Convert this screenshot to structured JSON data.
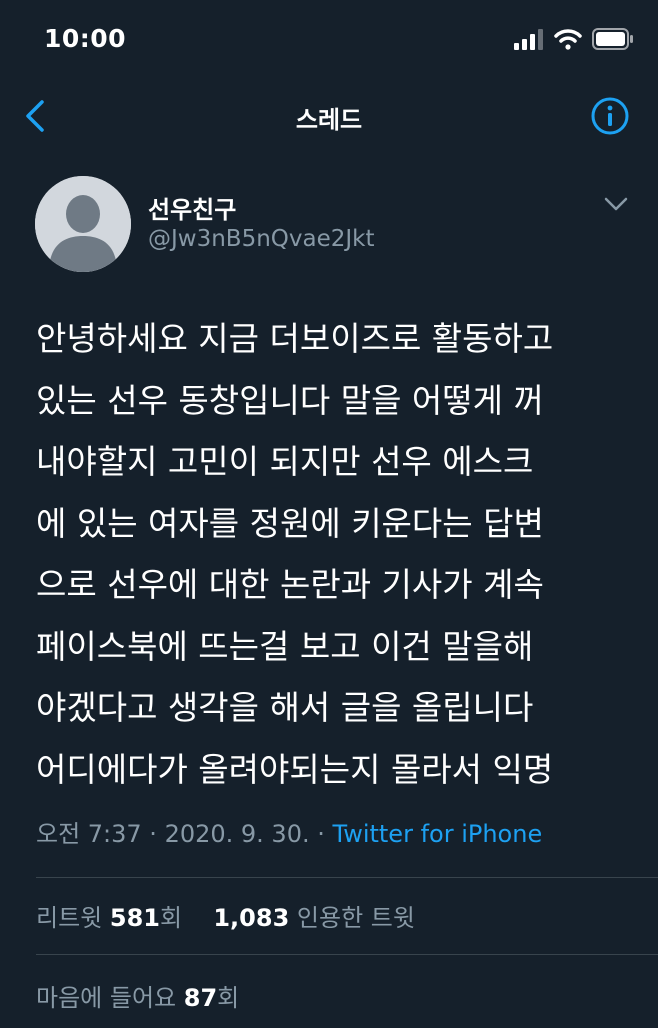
{
  "status_bar": {
    "time": "10:00",
    "icons": [
      "cellular-signal-icon",
      "wifi-icon",
      "battery-icon"
    ]
  },
  "nav": {
    "back_icon": "chevron-left-icon",
    "title": "스레드",
    "info_icon": "info-icon"
  },
  "tweet": {
    "author": {
      "display_name": "선우친구",
      "handle": "@Jw3nB5nQvae2Jkt",
      "avatar": "default-avatar-icon"
    },
    "text_lines": [
      "안녕하세요 지금 더보이즈로 활동하고",
      "있는 선우 동창입니다 말을 어떻게 꺼",
      "내야할지 고민이 되지만 선우 에스크",
      "에 있는 여자를 정원에 키운다는 답변",
      "으로 선우에 대한 논란과 기사가 계속",
      "페이스북에 뜨는걸 보고 이건 말을해",
      "야겠다고 생각을 해서 글을 올립니다",
      "어디에다가 올려야되는지 몰라서 익명"
    ],
    "timestamp": "오전 7:37 · 2020. 9. 30. · ",
    "source": "Twitter for iPhone",
    "retweets": {
      "label": "리트윗 ",
      "count": "581",
      "suffix": "회"
    },
    "quotes": {
      "count": "1,083",
      "label": " 인용한 트윗"
    },
    "likes": {
      "label": "마음에 들어요 ",
      "count": "87",
      "suffix": "회"
    }
  },
  "colors": {
    "background": "#15202b",
    "accent": "#1da1f2",
    "secondary_text": "#8899a6",
    "divider": "#38444d"
  }
}
